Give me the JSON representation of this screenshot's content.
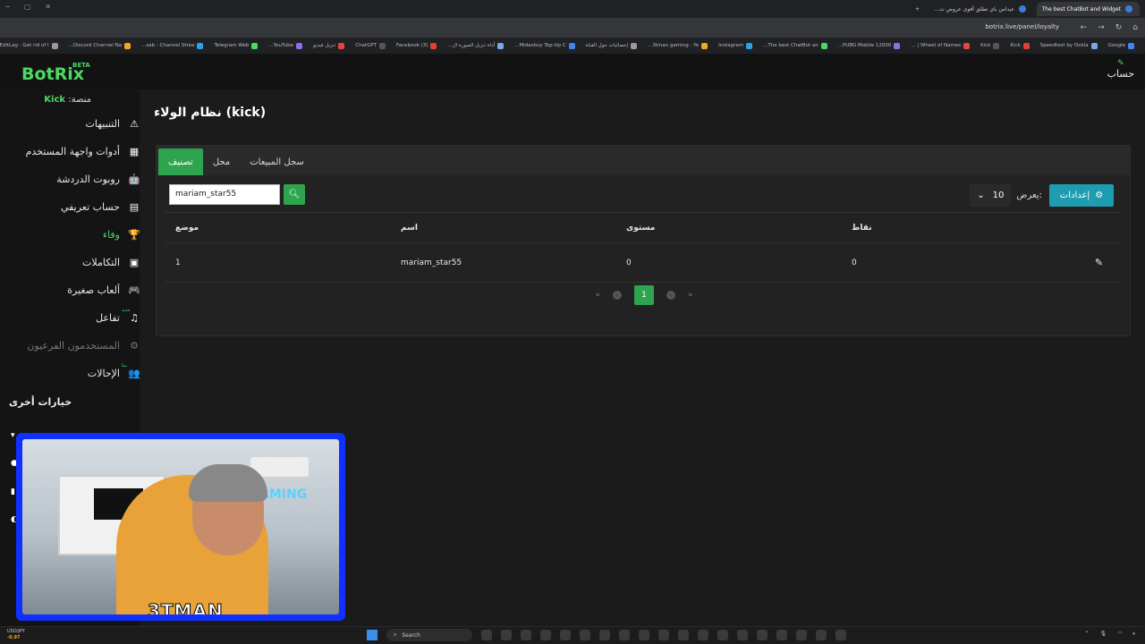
{
  "browser": {
    "tabs": [
      {
        "title": "The best ChatBot and Widget"
      },
      {
        "title": "عيداس باي تطلق أقوى عروض ت..."
      }
    ],
    "url": "botrix.live/panel/loyalty",
    "bookmarks": [
      "Google",
      "Speedtest by Ookla",
      "Kick",
      "Kick",
      "Wheel of Names | ...",
      "PUBG Mobile 12000...",
      "The best ChatBot an...",
      "Instagram",
      "3tman gaming - Yo...",
      "إحصائيات حول القناة",
      "Midasbuy Top-Up C...",
      "أداة تنزيل الصورة ال...",
      "(3) Facebook",
      "ChatGPT",
      "تنزيل فيديو",
      "YouTube...",
      "Telegram Web",
      "sab - Channel Strea...",
      "Discord Channel Na...",
      "EditLag - Get rid of l..."
    ]
  },
  "header": {
    "logo": "BotRix",
    "beta": "BETA",
    "account": "حساب"
  },
  "sidebar": {
    "platform_label": "منصة:",
    "platform_value": "Kick",
    "items": [
      {
        "label": "التنبيهات",
        "icon": "⚠"
      },
      {
        "label": "أدوات واجهة المستخدم",
        "icon": "▦"
      },
      {
        "label": "روبوت الدردشة",
        "icon": "🤖"
      },
      {
        "label": "حساب تعريفي",
        "icon": "▤"
      },
      {
        "label": "وفاء",
        "icon": "🏆"
      },
      {
        "label": "التكاملات",
        "icon": "▣"
      },
      {
        "label": "ألعاب صغيرة",
        "icon": "🎮"
      },
      {
        "label": "تفاعل",
        "icon": "♫",
        "badge": "جديد"
      },
      {
        "label": "المستخدمون الفرعيون",
        "icon": "⚙"
      },
      {
        "label": "الإحالات",
        "icon": "👥",
        "badge": "بيتا"
      }
    ],
    "other_heading": "خيارات أخرى"
  },
  "main": {
    "title": "نظام الولاء (kick)",
    "tabs": [
      "تصنيف",
      "محل",
      "سجل المبيعات"
    ],
    "search_value": "mariam_star55",
    "show_label": "يعرض:",
    "show_value": "10",
    "settings_label": "إعدادات",
    "columns": [
      "موضع",
      "اسم",
      "مستوى",
      "نقاط"
    ],
    "rows": [
      {
        "position": "1",
        "name": "mariam_star55",
        "level": "0",
        "points": "0"
      }
    ],
    "current_page": "1"
  },
  "webcam": {
    "overlay_name": "3TMAN",
    "wall_text": "AMING"
  },
  "taskbar": {
    "ticker_label": "USD/JPY",
    "ticker_value": "-0.97",
    "search_placeholder": "Search"
  }
}
